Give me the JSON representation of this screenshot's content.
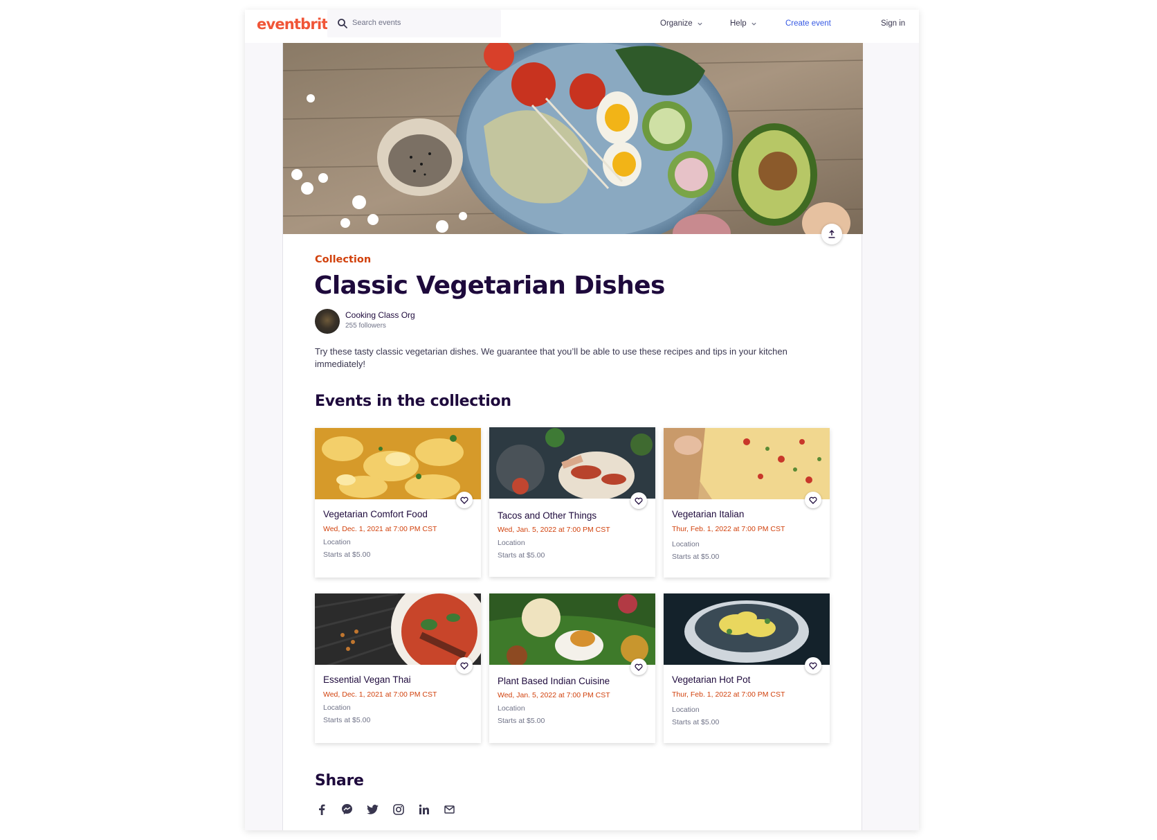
{
  "header": {
    "logo": "eventbrite",
    "search_placeholder": "Search events",
    "nav": {
      "organize": "Organize",
      "help": "Help",
      "create_event": "Create event",
      "sign_in": "Sign in"
    }
  },
  "collection": {
    "kicker": "Collection",
    "title": "Classic Vegetarian Dishes",
    "organizer": {
      "name": "Cooking Class Org",
      "followers": "255 followers"
    },
    "description": "Try these tasty classic vegetarian dishes. We guarantee that you’ll be able to use these recipes and tips in your kitchen immediately!"
  },
  "events_section": {
    "title": "Events in the collection"
  },
  "events": [
    {
      "title": "Vegetarian Comfort Food",
      "date": "Wed, Dec. 1, 2021 at 7:00 PM CST",
      "location": "Location",
      "price": "Starts at $5.00",
      "image": "mac-and-cheese"
    },
    {
      "title": "Tacos and Other Things",
      "date": "Wed, Jan. 5, 2022 at 7:00 PM CST",
      "location": "Location",
      "price": "Starts at $5.00",
      "image": "tacos"
    },
    {
      "title": "Vegetarian Italian",
      "date": "Thur, Feb. 1, 2022 at 7:00 PM CST",
      "location": "Location",
      "price": "Starts at $5.00",
      "image": "pizza"
    },
    {
      "title": "Essential Vegan Thai",
      "date": "Wed, Dec. 1, 2021 at 7:00 PM CST",
      "location": "Location",
      "price": "Starts at $5.00",
      "image": "thai-curry"
    },
    {
      "title": "Plant Based Indian Cuisine",
      "date": "Wed, Jan. 5, 2022 at 7:00 PM CST",
      "location": "Location",
      "price": "Starts at $5.00",
      "image": "indian-thali"
    },
    {
      "title": "Vegetarian Hot Pot",
      "date": "Thur, Feb. 1, 2022 at 7:00 PM CST",
      "location": "Location",
      "price": "Starts at $5.00",
      "image": "hot-pot"
    }
  ],
  "share_section": {
    "title": "Share",
    "icons": [
      "facebook-icon",
      "messenger-icon",
      "twitter-icon",
      "instagram-icon",
      "linkedin-icon",
      "email-icon"
    ]
  },
  "colors": {
    "brand": "#f05537",
    "accent_orange": "#d1410c",
    "link_blue": "#3659e3",
    "heading": "#1e0a3c",
    "muted": "#6f7287"
  }
}
